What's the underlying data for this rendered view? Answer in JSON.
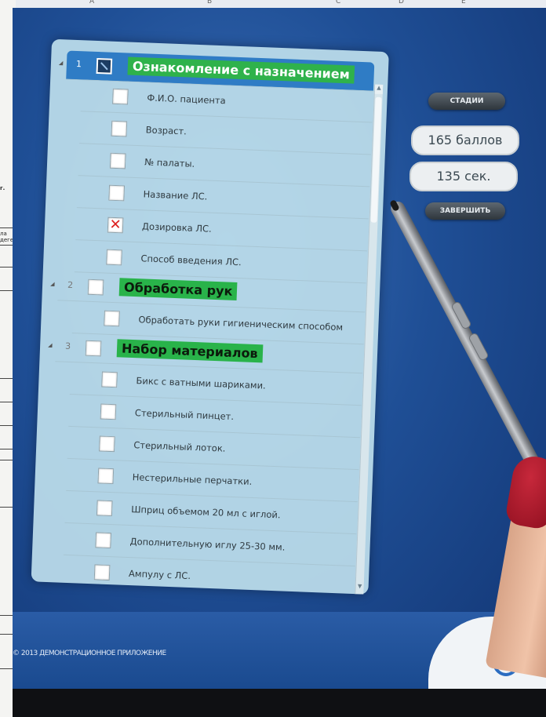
{
  "background_doc": {
    "column_letters": [
      "A",
      "B",
      "C",
      "D",
      "E"
    ],
    "fragments": [
      "г.",
      "ла",
      "деге"
    ]
  },
  "checklist": {
    "sections": [
      {
        "number": "1",
        "title": "Ознакомление с назначением",
        "items": [
          {
            "label": "Ф.И.О. пациента",
            "checked": false
          },
          {
            "label": "Возраст.",
            "checked": false
          },
          {
            "label": "№ палаты.",
            "checked": false
          },
          {
            "label": "Название ЛС.",
            "checked": false
          },
          {
            "label": "Дозировка ЛС.",
            "checked": true
          },
          {
            "label": "Способ введения ЛС.",
            "checked": false
          }
        ]
      },
      {
        "number": "2",
        "title": "Обработка рук",
        "items": [
          {
            "label": "Обработать руки гигиеническим способом",
            "checked": false
          }
        ]
      },
      {
        "number": "3",
        "title": "Набор материалов",
        "items": [
          {
            "label": "Бикс с ватными шариками.",
            "checked": false
          },
          {
            "label": "Стерильный пинцет.",
            "checked": false
          },
          {
            "label": "Стерильный лоток.",
            "checked": false
          },
          {
            "label": "Нестерильные перчатки.",
            "checked": false
          },
          {
            "label": "Шприц объемом 20 мл с иглой.",
            "checked": false
          },
          {
            "label": "Дополнительную иглу 25-30 мм.",
            "checked": false
          },
          {
            "label": "Ампулу с ЛС.",
            "checked": false
          }
        ]
      }
    ]
  },
  "controls": {
    "stages_button": "СТАДИИ",
    "score": "165 баллов",
    "timer": "135 сек.",
    "finish_button": "ЗАВЕРШИТЬ"
  },
  "footer": {
    "text": "© 2013 ДЕМОНСТРАЦИОННОЕ ПРИЛОЖЕНИЕ"
  },
  "colors": {
    "screen_blue": "#1f4f96",
    "section_green": "#29b34a",
    "selected_row": "#2f7cc5",
    "check_mark": "#dd2222"
  }
}
